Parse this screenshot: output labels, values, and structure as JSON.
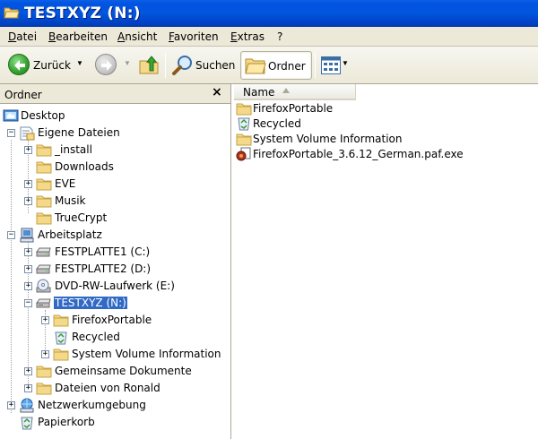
{
  "window": {
    "title": "TESTXYZ (N:)"
  },
  "menu": [
    "Datei",
    "Bearbeiten",
    "Ansicht",
    "Favoriten",
    "Extras",
    "?"
  ],
  "toolbar": {
    "back_label": "Zurück",
    "search_label": "Suchen",
    "folders_label": "Ordner"
  },
  "folder_pane": {
    "title": "Ordner",
    "close": "×",
    "tree": [
      {
        "label": "Desktop",
        "icon": "desktop-icon"
      },
      {
        "label": "Eigene Dateien",
        "icon": "my-documents-icon",
        "expanded": true
      },
      {
        "label": "_install",
        "icon": "folder-icon",
        "expander": "+"
      },
      {
        "label": "Downloads",
        "icon": "folder-icon"
      },
      {
        "label": "EVE",
        "icon": "folder-icon",
        "expander": "+"
      },
      {
        "label": "Musik",
        "icon": "folder-icon",
        "expander": "+"
      },
      {
        "label": "TrueCrypt",
        "icon": "folder-icon"
      },
      {
        "label": "Arbeitsplatz",
        "icon": "my-computer-icon",
        "expanded": true
      },
      {
        "label": "FESTPLATTE1 (C:)",
        "icon": "hard-drive-icon",
        "expander": "+"
      },
      {
        "label": "FESTPLATTE2 (D:)",
        "icon": "hard-drive-icon",
        "expander": "+"
      },
      {
        "label": "DVD-RW-Laufwerk (E:)",
        "icon": "dvd-drive-icon",
        "expander": "+"
      },
      {
        "label": "TESTXYZ (N:)",
        "icon": "removable-drive-icon",
        "expander": "-",
        "selected": true
      },
      {
        "label": "FirefoxPortable",
        "icon": "folder-icon",
        "expander": "+"
      },
      {
        "label": "Recycled",
        "icon": "recycle-bin-icon"
      },
      {
        "label": "System Volume Information",
        "icon": "folder-icon",
        "expander": "+"
      },
      {
        "label": "Gemeinsame Dokumente",
        "icon": "folder-icon",
        "expander": "+"
      },
      {
        "label": "Dateien von Ronald",
        "icon": "folder-icon",
        "expander": "+"
      },
      {
        "label": "Netzwerkumgebung",
        "icon": "network-icon",
        "expander": "+"
      },
      {
        "label": "Papierkorb",
        "icon": "recycle-bin-icon"
      }
    ]
  },
  "file_pane": {
    "column_name": "Name",
    "files": [
      {
        "name": "FirefoxPortable",
        "icon": "folder-icon"
      },
      {
        "name": "Recycled",
        "icon": "recycle-bin-icon"
      },
      {
        "name": "System Volume Information",
        "icon": "folder-icon"
      },
      {
        "name": "FirefoxPortable_3.6.12_German.paf.exe",
        "icon": "installer-icon"
      }
    ]
  },
  "colors": {
    "titlebar": "#0054e3",
    "chrome": "#ece9d8",
    "selection": "#316ac5"
  }
}
